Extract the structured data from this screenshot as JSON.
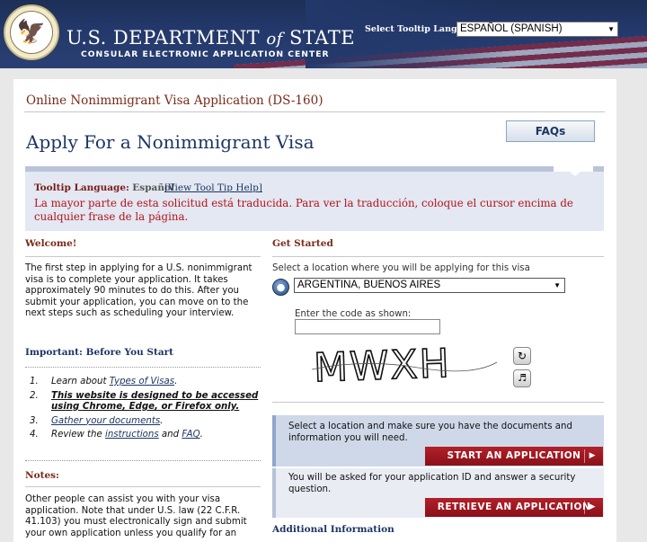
{
  "header": {
    "department": "U.S. DEPARTMENT",
    "department_of": "of",
    "department_state": "STATE",
    "subtitle": "CONSULAR ELECTRONIC APPLICATION CENTER",
    "tooltip_language_label": "Select Tooltip Language",
    "tooltip_language_value": "ESPAÑOL (SPANISH)"
  },
  "page": {
    "form_line": "Online Nonimmigrant Visa Application (DS-160)",
    "title": "Apply For a Nonimmigrant Visa",
    "faqs_label": "FAQs"
  },
  "tooltip_box": {
    "label": "Tooltip Language:",
    "language": "Español",
    "help_link": "[View Tool Tip Help]",
    "message": "La mayor parte de esta solicitud está traducida. Para ver la traducción, coloque el cursor encima de cualquier frase de la página."
  },
  "welcome": {
    "heading": "Welcome!",
    "text": "The first step in applying for a U.S. nonimmigrant visa is to complete your application. It takes approximately 90 minutes to do this. After you submit your application, you can move on to the next steps such as scheduling your interview."
  },
  "important": {
    "heading": "Important: Before You Start",
    "steps": [
      {
        "num": "1.",
        "pre": "Learn about ",
        "link": "Types of Visas",
        "post": "."
      },
      {
        "num": "2.",
        "bold": "This website is designed to be accessed using Chrome, Edge, or Firefox only."
      },
      {
        "num": "3.",
        "link": "Gather your documents",
        "post": "."
      },
      {
        "num": "4.",
        "pre": "Review the ",
        "link": "instructions",
        "mid": " and ",
        "link2": "FAQ",
        "post": "."
      }
    ]
  },
  "notes": {
    "heading": "Notes:",
    "text": "Other people can assist you with your visa application. Note that under U.S. law (22 C.F.R. 41.103) you must electronically sign and submit your own application unless you qualify for an"
  },
  "get_started": {
    "heading": "Get Started",
    "location_label": "Select a location where you will be applying for this visa",
    "location_value": "ARGENTINA, BUENOS AIRES",
    "code_label": "Enter the code as shown:",
    "code_value": "",
    "captcha_text": "MWXH",
    "start_text": "Select a location and make sure you have the documents and information you will need.",
    "start_button": "START AN APPLICATION",
    "retrieve_text": "You will be asked for your application ID and answer a security question.",
    "retrieve_button": "RETRIEVE AN APPLICATION",
    "additional_heading": "Additional Information"
  }
}
